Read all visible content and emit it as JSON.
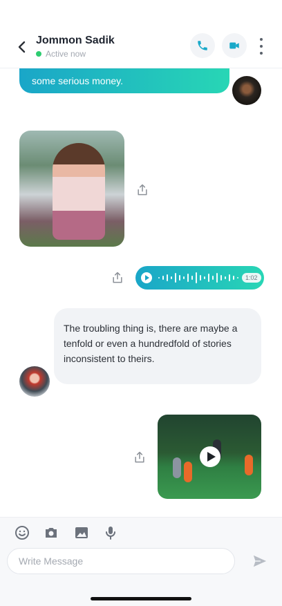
{
  "header": {
    "contact_name": "Jommon Sadik",
    "status": "Active now"
  },
  "messages": {
    "out_text_partial": "some serious money.",
    "voice_duration": "1:02",
    "in_text": "The troubling thing is, there are maybe a tenfold or even a hundredfold of stories inconsistent to theirs."
  },
  "composer": {
    "placeholder": "Write Message"
  },
  "colors": {
    "accent_start": "#1aa6c8",
    "accent_end": "#28d6b5",
    "online": "#2ecc71"
  },
  "icons": [
    "back-arrow-icon",
    "phone-icon",
    "video-icon",
    "more-icon",
    "share-icon",
    "play-icon",
    "emoji-icon",
    "camera-icon",
    "image-icon",
    "mic-icon",
    "send-icon"
  ]
}
